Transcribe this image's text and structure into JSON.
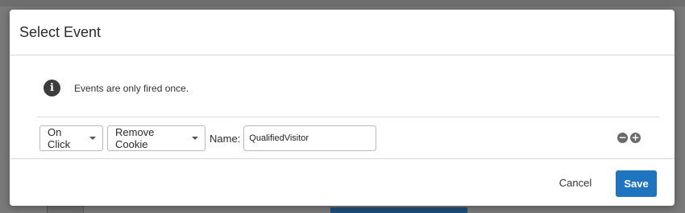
{
  "dialog": {
    "title": "Select Event",
    "info_icon": "info-icon",
    "info_text": "Events are only fired once."
  },
  "event_row": {
    "trigger": "On Click",
    "action": "Remove Cookie",
    "name_label": "Name:",
    "name_value": "QualifiedVisitor",
    "remove_icon": "minus-circle-icon",
    "add_icon": "plus-circle-icon"
  },
  "footer": {
    "cancel_label": "Cancel",
    "save_label": "Save",
    "save_color": "#1f74bf"
  }
}
